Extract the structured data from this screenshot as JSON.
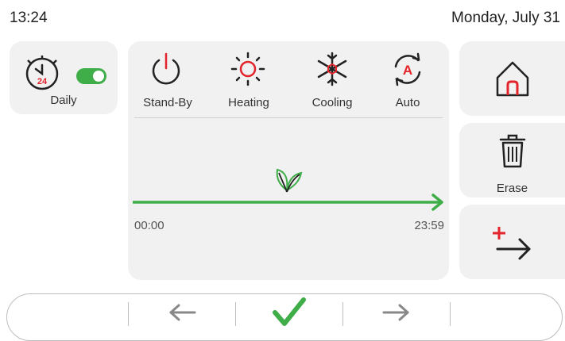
{
  "status_bar": {
    "time": "13:24",
    "date": "Monday, July 31"
  },
  "schedule": {
    "label": "Daily",
    "clock_badge": "24",
    "enabled": true
  },
  "modes": [
    {
      "label": "Stand-By",
      "icon": "power-icon"
    },
    {
      "label": "Heating",
      "icon": "sun-icon"
    },
    {
      "label": "Cooling",
      "icon": "snowflake-icon"
    },
    {
      "label": "Auto",
      "icon": "auto-icon",
      "badge": "A"
    }
  ],
  "timeline": {
    "start": "00:00",
    "end": "23:59",
    "icon": "leaf-icon"
  },
  "side_actions": {
    "home": {
      "icon": "home-icon"
    },
    "erase": {
      "label": "Erase",
      "icon": "trash-icon"
    },
    "add": {
      "icon": "add-arrow-icon"
    }
  },
  "bottom_nav": {
    "prev": "arrow-left-icon",
    "confirm": "check-icon",
    "next": "arrow-right-icon"
  },
  "colors": {
    "accent_red": "#e3242b",
    "green": "#3fae49",
    "card": "#f1f1f1"
  }
}
